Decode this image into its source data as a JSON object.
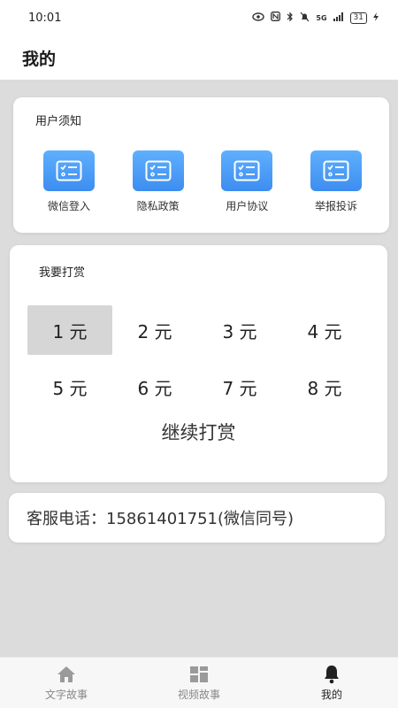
{
  "status_bar": {
    "time": "10:01",
    "signal_text": "5G",
    "battery_level": "31"
  },
  "header": {
    "title": "我的"
  },
  "notice": {
    "title": "用户须知",
    "items": [
      {
        "label": "微信登入",
        "icon": "document-check-icon"
      },
      {
        "label": "隐私政策",
        "icon": "document-check-icon"
      },
      {
        "label": "用户协议",
        "icon": "document-check-icon"
      },
      {
        "label": "举报投诉",
        "icon": "document-check-icon"
      }
    ]
  },
  "reward": {
    "title": "我要打赏",
    "amounts": [
      "1 元",
      "2 元",
      "3 元",
      "4 元",
      "5 元",
      "6 元",
      "7 元",
      "8 元"
    ],
    "selected_amount": "1 元",
    "continue_label": "继续打赏"
  },
  "contact": {
    "phone_text": "客服电话：15861401751(微信同号)"
  },
  "tabs": [
    {
      "label": "文字故事",
      "icon": "home-icon",
      "active": false
    },
    {
      "label": "视频故事",
      "icon": "grid-icon",
      "active": false
    },
    {
      "label": "我的",
      "icon": "bell-icon",
      "active": true
    }
  ],
  "colors": {
    "accent": "#4a9cf6",
    "selected_bg": "#d6d6d6",
    "page_bg": "#dcdcdc"
  }
}
